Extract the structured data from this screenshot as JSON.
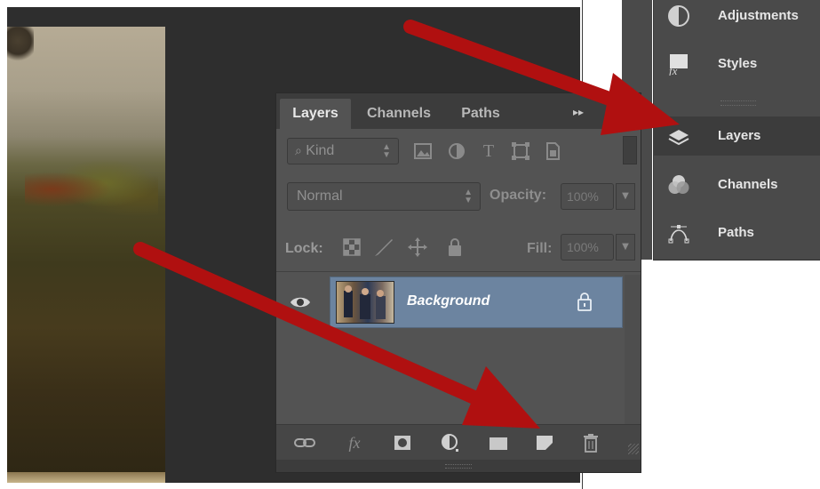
{
  "dock": {
    "items": [
      {
        "label": "Adjustments",
        "icon": "adjustments-icon"
      },
      {
        "label": "Styles",
        "icon": "styles-fx-icon"
      },
      {
        "label": "Layers",
        "icon": "layers-icon"
      },
      {
        "label": "Channels",
        "icon": "channels-icon"
      },
      {
        "label": "Paths",
        "icon": "paths-icon"
      }
    ]
  },
  "layers_panel": {
    "tabs": [
      {
        "label": "Layers"
      },
      {
        "label": "Channels"
      },
      {
        "label": "Paths"
      }
    ],
    "panel_menu_glyph": "▸▸",
    "filter": {
      "kind_label": "Kind",
      "icons": [
        "image-filter-icon",
        "adjustment-filter-icon",
        "type-filter-icon",
        "shape-filter-icon",
        "smart-object-filter-icon"
      ]
    },
    "blend_mode": "Normal",
    "opacity_label": "Opacity:",
    "opacity_value": "100%",
    "lock_label": "Lock:",
    "fill_label": "Fill:",
    "fill_value": "100%",
    "layers": [
      {
        "name": "Background",
        "visible": true,
        "locked": true,
        "selected": true
      }
    ],
    "bottom_icons": [
      "link-layers-icon",
      "fx-icon",
      "add-mask-icon",
      "adjustment-layer-icon",
      "group-folder-icon",
      "new-layer-icon",
      "trash-icon"
    ]
  },
  "colors": {
    "selection": "#6c84a0",
    "arrow": "#b01010",
    "panel_bg": "#535353",
    "dock_bg": "#4a4a4a"
  }
}
